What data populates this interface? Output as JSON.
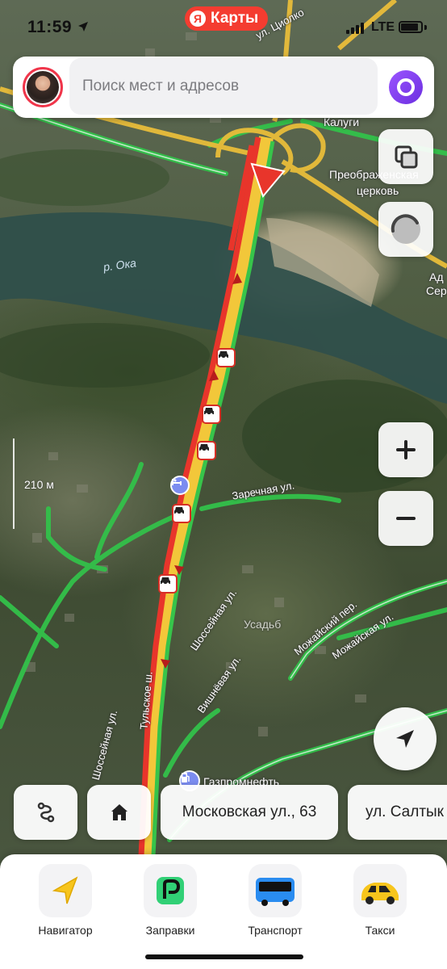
{
  "status_bar": {
    "time": "11:59",
    "network": "LTE",
    "app_badge": "Карты",
    "app_badge_letter": "Я"
  },
  "search": {
    "placeholder": "Поиск мест и адресов"
  },
  "map": {
    "labels": {
      "street_tsiolkovsky": "ул. Циолко",
      "city_kaluga": "Калуги",
      "church": "Преображенская",
      "church_2": "церковь",
      "edge_1": "Ад",
      "edge_2": "Сер",
      "river": "р. Ока",
      "scale": "210 м",
      "zarechnaya": "Заречная ул.",
      "shosseynaya_1": "Шоссейная ул.",
      "shosseynaya_2": "Шоссейная ул.",
      "vishnevaya": "Вишнёвая ул.",
      "mozhaisky_per": "Можайский пер.",
      "mozhaiskaya": "Можайская ул.",
      "tulskoe": "Тульское ш.",
      "gazpromneft": "Газпромнефть",
      "usadby": "Усадьб"
    },
    "traffic_incidents": 7
  },
  "quick_chips": {
    "address_1": "Московская ул., 63",
    "address_2": "ул. Салтык"
  },
  "bottom_nav": {
    "items": [
      {
        "label": "Навигатор",
        "icon": "navigator-arrow-icon"
      },
      {
        "label": "Заправки",
        "icon": "fuel-station-icon"
      },
      {
        "label": "Транспорт",
        "icon": "bus-icon"
      },
      {
        "label": "Такси",
        "icon": "taxi-car-icon"
      }
    ]
  },
  "colors": {
    "traffic_red": "#e8352b",
    "traffic_yellow": "#f2c73a",
    "traffic_green": "#37c44a",
    "alice_purple": "#7b3ff2",
    "brand_red": "#f43c30"
  }
}
